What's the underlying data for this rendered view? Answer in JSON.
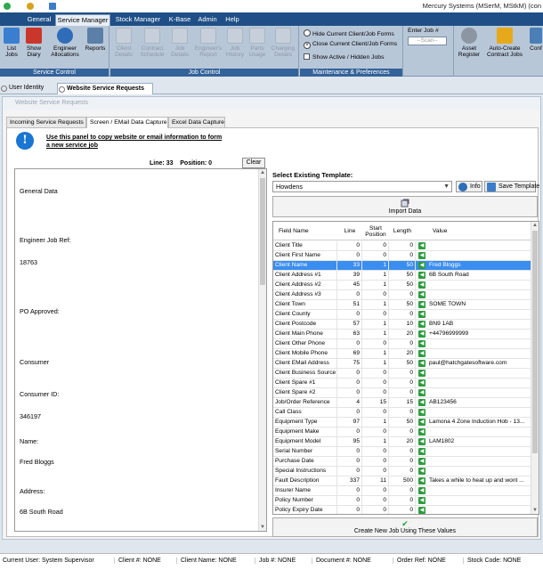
{
  "window": {
    "title": "Mercury Systems (MSerM, MStkM) (con"
  },
  "menu": {
    "tabs": [
      "General",
      "Service Manager",
      "Stock Manager",
      "K-Base",
      "Admin",
      "Help"
    ],
    "active": "Service Manager"
  },
  "ribbon": {
    "groups": {
      "service_control": "Service Control",
      "job_control": "Job Control",
      "maintenance": "Maintenance & Preferences"
    },
    "buttons": {
      "list_jobs": "List Jobs",
      "show_diary": "Show Diary",
      "engineer_allocations": "Engineer Allocations",
      "reports": "Reports",
      "client_details": "Client Details",
      "contract_schedule": "Contract Schedule",
      "job_details": "Job Details",
      "engineers_report": "Engineer's Report",
      "job_history": "Job History",
      "parts_usage": "Parts Usage",
      "charging_details": "Charging Details",
      "asset_register": "Asset Register",
      "auto_create": "Auto-Create Contract Jobs",
      "conf": "Conf"
    },
    "options": {
      "hide_forms": "Hide Current Client/Job Forms",
      "close_forms": "Close Current Client/Job Forms",
      "show_active": "Show Active / Hidden Jobs"
    },
    "enter_job_label": "Enter Job #",
    "enter_job_placeholder": "--Scan--"
  },
  "doc_tabs": [
    "User Identity",
    "Website Service Requests"
  ],
  "form": {
    "title": "Website Service Requests",
    "subtabs": [
      "Incoming Service Requests",
      "Screen / EMail Data Capture",
      "Excel Data Capture"
    ],
    "info_text": "Use this panel to copy website or email information to form a new service job",
    "line_label": "Line:",
    "line_value": "33",
    "position_label": "Position:",
    "position_value": "0",
    "clear_label": "Clear",
    "editor_lines": [
      "General Data",
      "Engineer Job Ref:",
      "18763",
      "PO Approved:",
      "Consumer",
      "Consumer ID:",
      "346197",
      "Name:",
      "Fred Bloggs",
      "Address:",
      "6B South Road"
    ],
    "template_label": "Select Existing Template:",
    "template_value": "Howdens",
    "info_button": "Info",
    "save_template_button": "Save Template",
    "import_button": "Import Data",
    "create_button": "Create New Job Using These Values",
    "grid": {
      "headers": [
        "Field Name",
        "Line",
        "Start Position",
        "Length",
        "",
        "Value"
      ],
      "selected_row": 2,
      "rows": [
        [
          "Client Title",
          "0",
          "0",
          "0",
          ""
        ],
        [
          "Client First Name",
          "0",
          "0",
          "0",
          ""
        ],
        [
          "Client Name",
          "33",
          "1",
          "50",
          "Fred Bloggs"
        ],
        [
          "Client Address #1",
          "39",
          "1",
          "50",
          "6B South Road"
        ],
        [
          "Client Address #2",
          "45",
          "1",
          "50",
          ""
        ],
        [
          "Client Address #3",
          "0",
          "0",
          "0",
          ""
        ],
        [
          "Client Town",
          "51",
          "1",
          "50",
          "SOME TOWN"
        ],
        [
          "Client County",
          "0",
          "0",
          "0",
          ""
        ],
        [
          "Client Postcode",
          "57",
          "1",
          "10",
          "BN9 1AB"
        ],
        [
          "Client Main Phone",
          "63",
          "1",
          "20",
          "+44796999999"
        ],
        [
          "Client Other Phone",
          "0",
          "0",
          "0",
          ""
        ],
        [
          "Client Mobile Phone",
          "69",
          "1",
          "20",
          ""
        ],
        [
          "Client EMail Address",
          "75",
          "1",
          "50",
          "paul@hatchgatesoftware.com"
        ],
        [
          "Client Business Source",
          "0",
          "0",
          "0",
          ""
        ],
        [
          "Client Spare #1",
          "0",
          "0",
          "0",
          ""
        ],
        [
          "Client Spare #2",
          "0",
          "0",
          "0",
          ""
        ],
        [
          "Job/Order Reference",
          "4",
          "15",
          "15",
          "AB123456"
        ],
        [
          "Call Class",
          "0",
          "0",
          "0",
          ""
        ],
        [
          "Equipment Type",
          "97",
          "1",
          "50",
          "Lamona 4 Zone Induction Hob - 13..."
        ],
        [
          "Equipment Make",
          "0",
          "0",
          "0",
          ""
        ],
        [
          "Equipment Model",
          "95",
          "1",
          "20",
          "LAM1802"
        ],
        [
          "Serial Number",
          "0",
          "0",
          "0",
          ""
        ],
        [
          "Purchase Date",
          "0",
          "0",
          "0",
          ""
        ],
        [
          "Special Instructions",
          "0",
          "0",
          "0",
          ""
        ],
        [
          "Fault Description",
          "337",
          "11",
          "500",
          "Takes a while to heat up and wont ..."
        ],
        [
          "Insurer Name",
          "0",
          "0",
          "0",
          ""
        ],
        [
          "Policy Number",
          "0",
          "0",
          "0",
          ""
        ],
        [
          "Policy Expiry Date",
          "0",
          "0",
          "0",
          ""
        ]
      ]
    }
  },
  "status": {
    "current_user": "Current User:  System Supervisor",
    "client_no": "Client #:  NONE",
    "client_name": "Client Name:  NONE",
    "job_no": "Job #:  NONE",
    "document_no": "Document #:  NONE",
    "order_ref": "Order Ref:  NONE",
    "stock_code": "Stock Code:  NONE"
  },
  "colors": {
    "menu_bg": "#1f4f86",
    "group_caption": "#34639a",
    "selected_row": "#3a8ef0",
    "arrow_green": "#2e9c3f"
  }
}
